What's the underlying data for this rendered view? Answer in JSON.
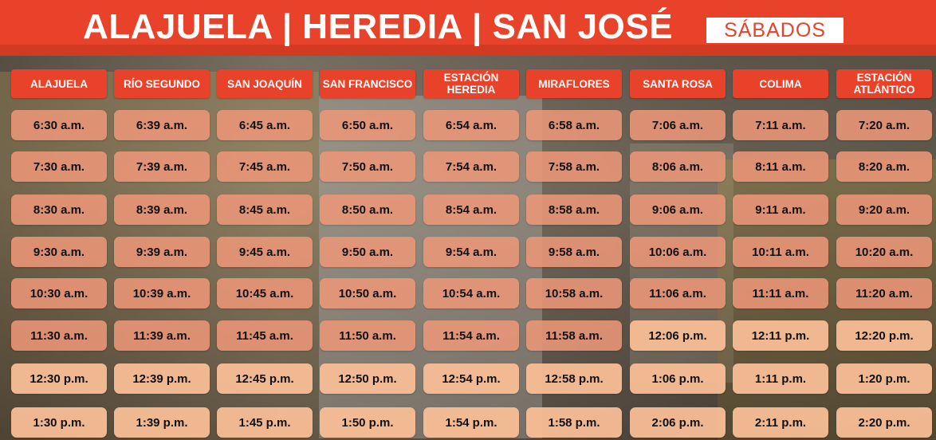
{
  "header": {
    "title": "ALAJUELA | HEREDIA | SAN JOSÉ",
    "day": "SÁBADOS"
  },
  "colors": {
    "accent": "#e8432a",
    "am_cell": "#ec9678",
    "pm_cell": "#f8be96"
  },
  "columns": [
    "ALAJUELA",
    "RÍO SEGUNDO",
    "SAN JOAQUÍN",
    "SAN FRANCISCO",
    "ESTACIÓN HEREDIA",
    "MIRAFLORES",
    "SANTA ROSA",
    "COLIMA",
    "ESTACIÓN ATLÁNTICO"
  ],
  "rows": [
    [
      "6:30 a.m.",
      "6:39 a.m.",
      "6:45 a.m.",
      "6:50 a.m.",
      "6:54 a.m.",
      "6:58 a.m.",
      "7:06 a.m.",
      "7:11 a.m.",
      "7:20 a.m."
    ],
    [
      "7:30 a.m.",
      "7:39 a.m.",
      "7:45 a.m.",
      "7:50 a.m.",
      "7:54 a.m.",
      "7:58 a.m.",
      "8:06 a.m.",
      "8:11 a.m.",
      "8:20 a.m."
    ],
    [
      "8:30 a.m.",
      "8:39 a.m.",
      "8:45 a.m.",
      "8:50 a.m.",
      "8:54 a.m.",
      "8:58 a.m.",
      "9:06 a.m.",
      "9:11 a.m.",
      "9:20 a.m."
    ],
    [
      "9:30 a.m.",
      "9:39 a.m.",
      "9:45 a.m.",
      "9:50 a.m.",
      "9:54 a.m.",
      "9:58 a.m.",
      "10:06 a.m.",
      "10:11 a.m.",
      "10:20 a.m."
    ],
    [
      "10:30 a.m.",
      "10:39 a.m.",
      "10:45 a.m.",
      "10:50 a.m.",
      "10:54 a.m.",
      "10:58 a.m.",
      "11:06 a.m.",
      "11:11 a.m.",
      "11:20 a.m."
    ],
    [
      "11:30 a.m.",
      "11:39 a.m.",
      "11:45 a.m.",
      "11:50 a.m.",
      "11:54 a.m.",
      "11:58 a.m.",
      "12:06 p.m.",
      "12:11 p.m.",
      "12:20 p.m."
    ],
    [
      "12:30 p.m.",
      "12:39 p.m.",
      "12:45 p.m.",
      "12:50 p.m.",
      "12:54 p.m.",
      "12:58 p.m.",
      "1:06 p.m.",
      "1:11 p.m.",
      "1:20 p.m."
    ],
    [
      "1:30 p.m.",
      "1:39 p.m.",
      "1:45 p.m.",
      "1:50 p.m.",
      "1:54 p.m.",
      "1:58 p.m.",
      "2:06 p.m.",
      "2:11 p.m.",
      "2:20 p.m."
    ]
  ]
}
